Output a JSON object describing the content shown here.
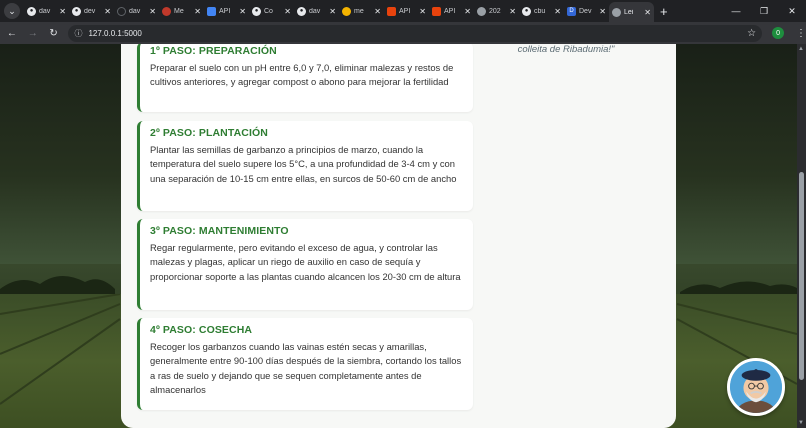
{
  "browser": {
    "tabs": [
      {
        "label": "dav",
        "icon": "github-icon",
        "color": "#24292f"
      },
      {
        "label": "dev",
        "icon": "github-icon",
        "color": "#24292f"
      },
      {
        "label": "dav",
        "icon": "blank-icon",
        "color": "#5f6368"
      },
      {
        "label": "Me",
        "icon": "app-icon",
        "color": "#c0392b"
      },
      {
        "label": "API",
        "icon": "api-icon",
        "color": "#4285f4"
      },
      {
        "label": "Co",
        "icon": "github-icon",
        "color": "#24292f"
      },
      {
        "label": "dav",
        "icon": "github-icon",
        "color": "#24292f"
      },
      {
        "label": "me",
        "icon": "emoji-icon",
        "color": "#f4b400"
      },
      {
        "label": "API",
        "icon": "brave-icon",
        "color": "#e8430d"
      },
      {
        "label": "API",
        "icon": "brave-icon",
        "color": "#e8430d"
      },
      {
        "label": "202",
        "icon": "globe-icon",
        "color": "#5f6368"
      },
      {
        "label": "cbu",
        "icon": "github-icon",
        "color": "#24292f"
      },
      {
        "label": "Dev",
        "icon": "dev-icon",
        "color": "#3367d6"
      },
      {
        "label": "Lei",
        "icon": "globe-icon",
        "color": "#5f6368"
      }
    ],
    "active_tab_index": 13,
    "url": "127.0.0.1:5000",
    "extension_badge": "0"
  },
  "page": {
    "quote": "colleita de Ribadumia!\"",
    "steps": [
      {
        "title": "1º PASO: PREPARACIÓN",
        "text": "Preparar el suelo con un pH entre 6,0 y 7,0, eliminar malezas y restos de cultivos anteriores, y agregar compost o abono para mejorar la fertilidad"
      },
      {
        "title": "2º PASO: PLANTACIÓN",
        "text": "Plantar las semillas de garbanzo a principios de marzo, cuando la temperatura del suelo supere los 5°C, a una profundidad de 3-4 cm y con una separación de 10-15 cm entre ellas, en surcos de 50-60 cm de ancho"
      },
      {
        "title": "3º PASO: MANTENIMIENTO",
        "text": "Regar regularmente, pero evitando el exceso de agua, y controlar las malezas y plagas, aplicar un riego de auxilio en caso de sequía y proporcionar soporte a las plantas cuando alcancen los 20-30 cm de altura"
      },
      {
        "title": "4º PASO: COSECHA",
        "text": "Recoger los garbanzos cuando las vainas estén secas y amarillas, generalmente entre 90-100 días después de la siembra, cortando los tallos a ras de suelo y dejando que se sequen completamente antes de almacenarlos"
      }
    ],
    "accent_color": "#2e7d32"
  }
}
